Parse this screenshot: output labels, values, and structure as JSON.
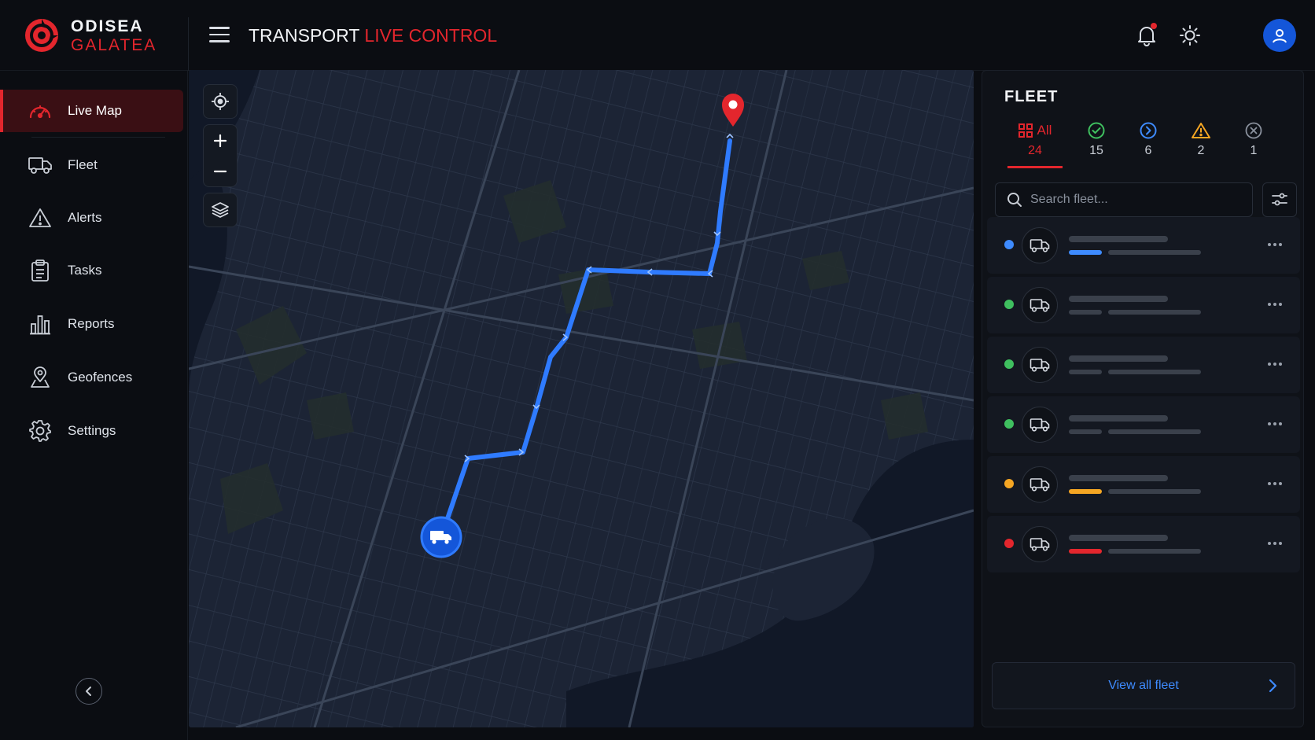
{
  "brand": {
    "line1": "ODISEA",
    "line2": "GALATEA"
  },
  "header": {
    "title_part1": "TRANSPORT",
    "title_part2": "LIVE CONTROL",
    "notification_badge": true,
    "icons": [
      "menu-icon",
      "bell-icon",
      "sun-icon",
      "user-avatar"
    ]
  },
  "sidebar": {
    "items": [
      {
        "label": "Live Map",
        "icon": "speedometer-icon",
        "active": true
      },
      {
        "label": "Fleet",
        "icon": "truck-icon"
      },
      {
        "label": "Alerts",
        "icon": "warning-icon"
      },
      {
        "label": "Tasks",
        "icon": "clipboard-icon"
      },
      {
        "label": "Reports",
        "icon": "bar-chart-icon"
      },
      {
        "label": "Geofences",
        "icon": "location-pin-icon"
      },
      {
        "label": "Settings",
        "icon": "gear-icon"
      }
    ],
    "collapse_icon": "chevron-left-icon"
  },
  "map": {
    "controls": [
      "locate-icon",
      "zoom-in-icon",
      "zoom-out-icon",
      "layers-icon"
    ],
    "route_color": "#2f7bff",
    "destination_color": "#e3262d"
  },
  "fleet": {
    "title": "FLEET",
    "tabs": [
      {
        "key": "all",
        "label": "All",
        "count": "24",
        "icon": "grid-icon",
        "color": "#e3262d",
        "active": true
      },
      {
        "key": "active",
        "count": "15",
        "icon": "check-circle-icon",
        "color": "#3fbf5f"
      },
      {
        "key": "moving",
        "count": "6",
        "icon": "arrow-circle-icon",
        "color": "#3e8bff"
      },
      {
        "key": "warning",
        "count": "2",
        "icon": "warning-triangle-icon",
        "color": "#f5a623"
      },
      {
        "key": "offline",
        "count": "1",
        "icon": "x-circle-icon",
        "color": "#8a919d"
      }
    ],
    "search_placeholder": "Search fleet...",
    "vehicles": [
      {
        "status_color": "#3e8bff",
        "progress_color": "#3e8bff"
      },
      {
        "status_color": "#3fbf5f",
        "progress_color": "#3a404b"
      },
      {
        "status_color": "#3fbf5f",
        "progress_color": "#3a404b"
      },
      {
        "status_color": "#3fbf5f",
        "progress_color": "#3a404b"
      },
      {
        "status_color": "#f5a623",
        "progress_color": "#f5a623"
      },
      {
        "status_color": "#e3262d",
        "progress_color": "#e3262d"
      }
    ],
    "view_all_label": "View all fleet"
  }
}
